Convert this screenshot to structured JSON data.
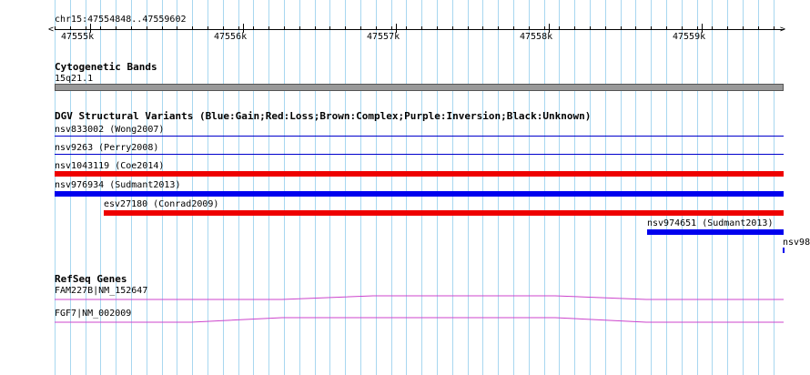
{
  "ruler": {
    "location": "chr15:47554848..47559602",
    "ticks": [
      "47555k",
      "47556k",
      "47557k",
      "47558k",
      "47559k"
    ]
  },
  "tracks": {
    "cytoband": {
      "title": "Cytogenetic Bands",
      "band_label": "15q21.1",
      "band_color": "#999999"
    },
    "dgv": {
      "title": "DGV Structural Variants (Blue:Gain;Red:Loss;Brown:Complex;Purple:Inversion;Black:Unknown)",
      "features": [
        {
          "label": "nsv833002 (Wong2007)",
          "type": "Gain",
          "color": "#0000cc",
          "style": "thin"
        },
        {
          "label": "nsv9263 (Perry2008)",
          "type": "Gain",
          "color": "#0000cc",
          "style": "thin"
        },
        {
          "label": "nsv1043119 (Coe2014)",
          "type": "Loss",
          "color": "#ee0000",
          "style": "thick"
        },
        {
          "label": "nsv976934 (Sudmant2013)",
          "type": "Gain",
          "color": "#0000ee",
          "style": "thick"
        },
        {
          "label": "esv27180 (Conrad2009)",
          "type": "Loss",
          "color": "#ee0000",
          "style": "thick"
        },
        {
          "label": "nsv974651 (Sudmant2013)",
          "type": "Gain",
          "color": "#0000ee",
          "style": "thick"
        },
        {
          "label": "nsv98",
          "type": "Gain",
          "color": "#0000ee",
          "style": "stub"
        }
      ]
    },
    "refseq": {
      "title": "RefSeq Genes",
      "genes": [
        {
          "label": "FAM227B|NM_152647",
          "color": "#cc44cc"
        },
        {
          "label": "FGF7|NM_002009",
          "color": "#cc44cc"
        }
      ]
    }
  },
  "colors": {
    "grid": "#a8d7f0",
    "ruler": "#000000"
  }
}
